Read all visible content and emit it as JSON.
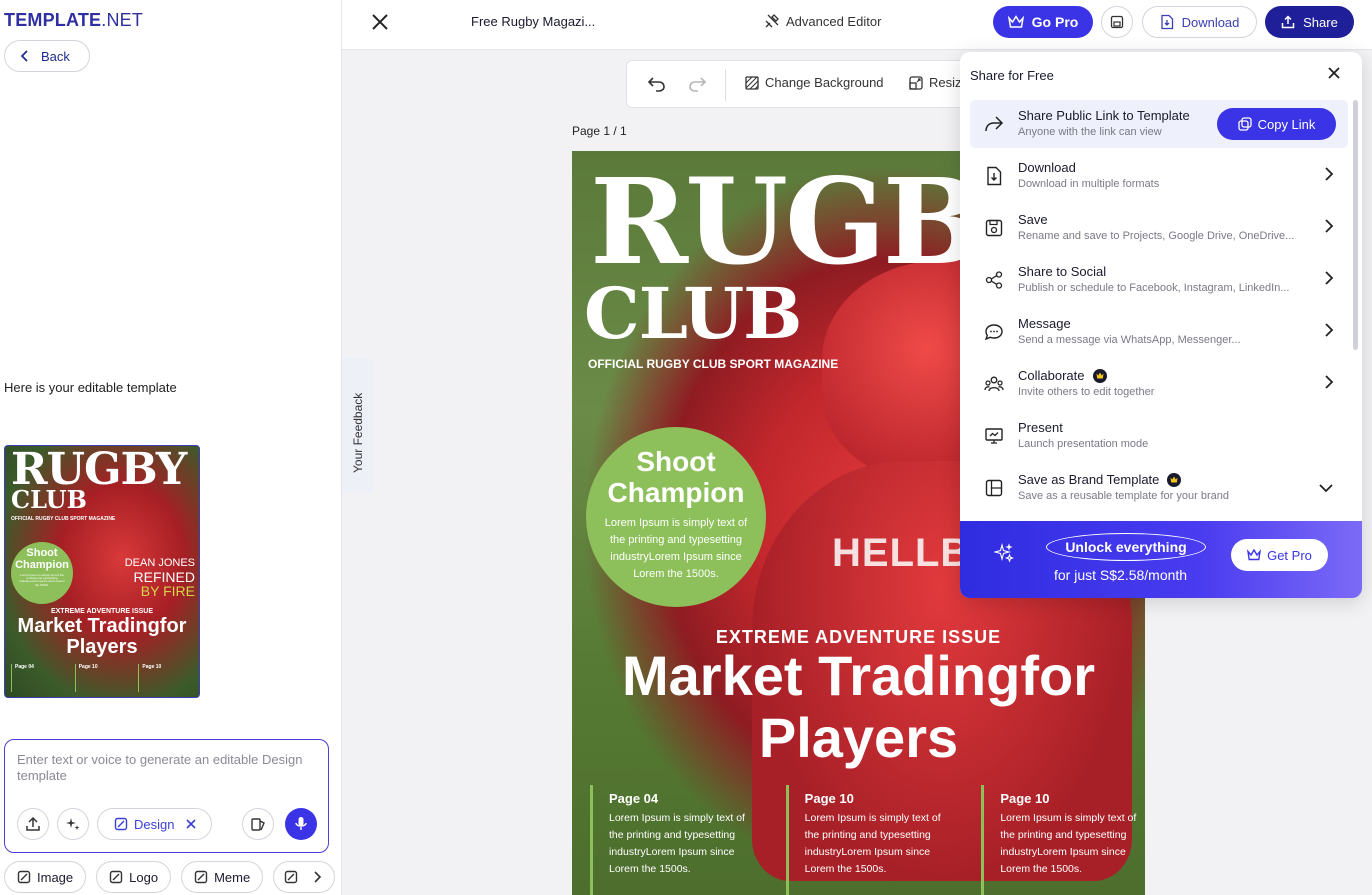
{
  "brand": {
    "logo_main": "TEMPLATE",
    "logo_suffix": ".NET"
  },
  "left_panel": {
    "back_label": "Back",
    "editable_label": "Here is your editable template",
    "thumbnail": {
      "title": "RUGBY",
      "subtitle": "CLUB",
      "tagline": "OFFICIAL RUGBY CLUB SPORT MAGAZINE",
      "circle_title": "Shoot Champion",
      "circle_text": "Lorem Ipsum is simply text of the printing and typesetting industryLorem Ipsum since Lorem the 1500s.",
      "dean": "DEAN JONES",
      "refined": "REFINED",
      "byfire": "BY FIRE",
      "issue": "EXTREME ADVENTURE ISSUE",
      "headline": "Market Tradingfor Players",
      "pages": [
        "Page 04",
        "Page 10",
        "Page 10"
      ]
    },
    "prompt": {
      "placeholder": "Enter text or voice to generate an editable Design template",
      "design_pill": "Design"
    },
    "chips": [
      "Image",
      "Logo",
      "Meme"
    ]
  },
  "topbar": {
    "doc_title": "Free Rugby Magazi...",
    "advanced_editor": "Advanced Editor",
    "go_pro": "Go Pro",
    "download": "Download",
    "share": "Share"
  },
  "canvas": {
    "toolbar": {
      "change_background": "Change Background",
      "resize": "Resiz"
    },
    "page_label": "Page 1 / 1",
    "feedback": "Your Feedback",
    "magazine": {
      "title": "RUGBY",
      "subtitle": "CLUB",
      "tagline": "OFFICIAL RUGBY CLUB SPORT MAGAZINE",
      "jersey_text": "HELLB",
      "circle_title": "Shoot Champion",
      "circle_text": "Lorem Ipsum is simply text of the printing and typesetting industryLorem Ipsum  since Lorem the 1500s.",
      "issue": "EXTREME ADVENTURE ISSUE",
      "headline": "Market Tradingfor Players",
      "pages": [
        {
          "title": "Page 04",
          "text": "Lorem Ipsum is simply text of the printing and typesetting industryLorem Ipsum  since Lorem the 1500s."
        },
        {
          "title": "Page 10",
          "text": "Lorem Ipsum is simply text of the printing and typesetting industryLorem Ipsum  since Lorem the 1500s."
        },
        {
          "title": "Page 10",
          "text": "Lorem Ipsum is simply text of the printing and typesetting industryLorem Ipsum  since Lorem the 1500s."
        }
      ]
    }
  },
  "share_panel": {
    "title": "Share for Free",
    "copy_link": "Copy Link",
    "items": [
      {
        "title": "Share Public Link to Template",
        "sub": "Anyone with the link can view"
      },
      {
        "title": "Download",
        "sub": "Download in multiple formats"
      },
      {
        "title": "Save",
        "sub": "Rename and save to Projects, Google Drive, OneDrive..."
      },
      {
        "title": "Share to Social",
        "sub": "Publish or schedule to Facebook, Instagram, LinkedIn..."
      },
      {
        "title": "Message",
        "sub": "Send a message via WhatsApp, Messenger..."
      },
      {
        "title": "Collaborate",
        "sub": "Invite others to edit together"
      },
      {
        "title": "Present",
        "sub": "Launch presentation mode"
      },
      {
        "title": "Save as Brand Template",
        "sub": "Save as a reusable template for your brand"
      }
    ],
    "unlock": {
      "title": "Unlock everything",
      "price": "for just S$2.58/month",
      "get_pro": "Get Pro"
    }
  },
  "colors": {
    "accent": "#3a34e6",
    "navy": "#1f1f99",
    "green": "#8dc05a"
  }
}
